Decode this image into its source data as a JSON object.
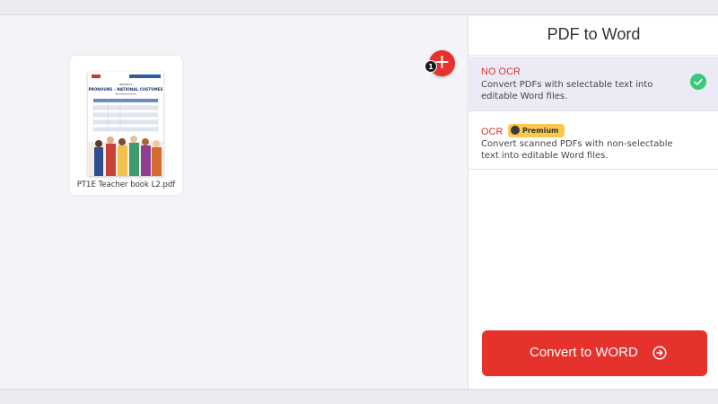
{
  "workspace": {
    "files": [
      {
        "name": "PT1E Teacher book L2.pdf"
      }
    ],
    "thumbnail": {
      "lesson": "LESSON 2",
      "heading": "PRONOUNS – NATIONAL COSTUMES"
    },
    "add_button": {
      "icon": "plus-icon",
      "symbol": "+"
    },
    "file_count": "1"
  },
  "sidebar": {
    "title": "PDF to Word",
    "options": [
      {
        "title": "NO OCR",
        "description": "Convert PDFs with selectable text into editable Word files.",
        "selected": true
      },
      {
        "title": "OCR",
        "badge": "Premium",
        "description": "Convert scanned PDFs with non-selectable text into editable Word files.",
        "selected": false
      }
    ],
    "convert_label": "Convert to WORD"
  },
  "colors": {
    "accent": "#e5322d",
    "check": "#3cc87c",
    "premium": "#fcc74a",
    "selected_bg": "#ebebf5"
  }
}
